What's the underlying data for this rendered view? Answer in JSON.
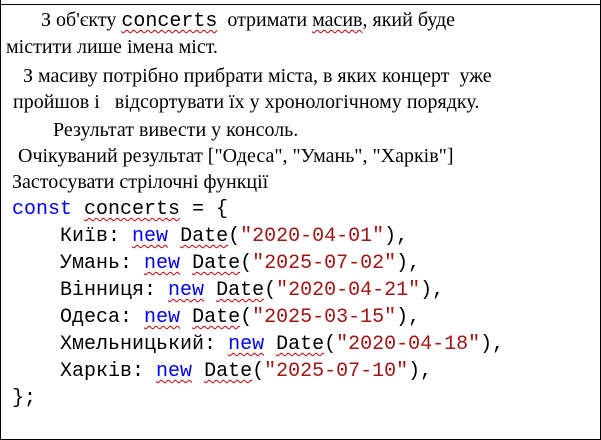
{
  "task": {
    "line1": {
      "pre": "З об'єкту ",
      "code_word": "concerts",
      "post_a": "  отримати ",
      "masyv": "масив",
      "post_b": ", який буде"
    },
    "line2": "містити лише імена міст.",
    "line3": "З масиву потрібно прибрати міста, в яких концерт  уже",
    "line4": "пройшов і   відсортувати їх у хронологічному порядку.",
    "line5": "Результат вивести у консоль.",
    "line6": "Очікуваний результат [\"Одеса\", \"Умань\", \"Харків\"]",
    "line7": "Застосувати стрілочні функції"
  },
  "code": {
    "keyword_const": "const",
    "object_name": "concerts",
    "open": " = {",
    "keyword_new": "new",
    "date_ctor": "Date",
    "close": "};",
    "entries": [
      {
        "city": "Київ",
        "date": "\"2020-04-01\""
      },
      {
        "city": "Умань",
        "date": "\"2025-07-02\""
      },
      {
        "city": "Вінниця",
        "date": "\"2020-04-21\""
      },
      {
        "city": "Одеса",
        "date": "\"2025-03-15\""
      },
      {
        "city": "Хмельницький",
        "date": "\"2020-04-18\""
      },
      {
        "city": "Харків",
        "date": "\"2025-07-10\""
      }
    ]
  },
  "colors": {
    "keyword": "#0000ff",
    "string": "#a31515",
    "text": "#000000",
    "spellcheck": "#d00000"
  }
}
